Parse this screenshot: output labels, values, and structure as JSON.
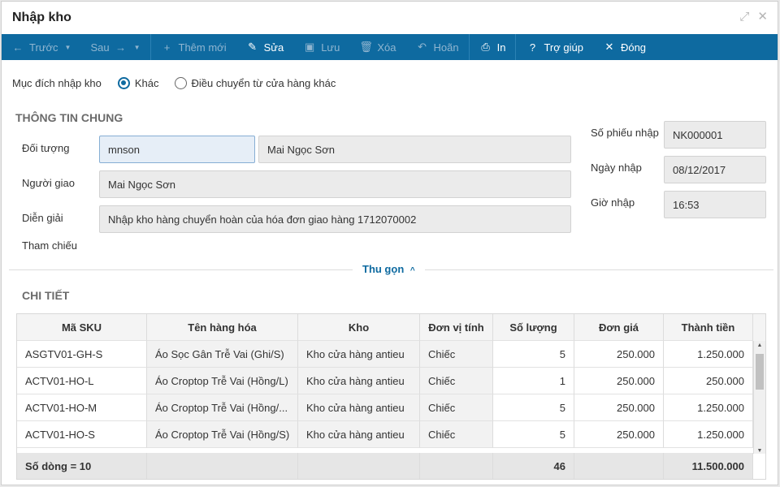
{
  "window": {
    "title": "Nhập kho"
  },
  "toolbar": [
    {
      "label": "Trước",
      "icon": "arrow-left-icon",
      "glyph": "←",
      "caret": true,
      "enabled": false
    },
    {
      "label": "Sau",
      "icon": "arrow-right-icon",
      "glyph": "→",
      "caret": true,
      "enabled": false,
      "icon_after": true
    },
    {
      "label": "Thêm mới",
      "icon": "plus-icon",
      "glyph": "+",
      "enabled": false
    },
    {
      "label": "Sửa",
      "icon": "pencil-icon",
      "glyph": "✎",
      "enabled": true
    },
    {
      "label": "Lưu",
      "icon": "save-icon",
      "glyph": "▣",
      "enabled": false
    },
    {
      "label": "Xóa",
      "icon": "trash-icon",
      "glyph": "🗑",
      "enabled": false
    },
    {
      "label": "Hoãn",
      "icon": "undo-icon",
      "glyph": "↶",
      "enabled": false
    },
    {
      "label": "In",
      "icon": "printer-icon",
      "glyph": "⎙",
      "enabled": true
    },
    {
      "label": "Trợ giúp",
      "icon": "help-icon",
      "glyph": "?",
      "enabled": true
    },
    {
      "label": "Đóng",
      "icon": "close-icon",
      "glyph": "✕",
      "enabled": true
    }
  ],
  "purpose": {
    "label": "Mục đích nhập kho",
    "options": [
      {
        "label": "Khác",
        "selected": true
      },
      {
        "label": "Điều chuyển từ cửa hàng khác",
        "selected": false
      }
    ]
  },
  "general": {
    "title": "THÔNG TIN CHUNG",
    "doi_tuong_label": "Đối tượng",
    "doi_tuong_code": "mnson",
    "doi_tuong_name": "Mai Ngọc Sơn",
    "nguoi_giao_label": "Người giao",
    "nguoi_giao": "Mai Ngọc Sơn",
    "dien_giai_label": "Diễn giải",
    "dien_giai": "Nhập kho hàng chuyển hoàn của hóa đơn giao hàng 1712070002",
    "tham_chieu_label": "Tham chiếu",
    "so_phieu_label": "Số phiếu nhập",
    "so_phieu": "NK000001",
    "ngay_nhap_label": "Ngày nhập",
    "ngay_nhap": "08/12/2017",
    "gio_nhap_label": "Giờ nhập",
    "gio_nhap": "16:53"
  },
  "collapse_label": "Thu gọn",
  "detail": {
    "title": "CHI TIẾT",
    "columns": [
      "Mã SKU",
      "Tên hàng hóa",
      "Kho",
      "Đơn vị tính",
      "Số lượng",
      "Đơn giá",
      "Thành tiền"
    ],
    "rows": [
      [
        "ASGTV01-GH-S",
        "Áo Sọc Gân Trễ Vai (Ghi/S)",
        "Kho cửa hàng antieu",
        "Chiếc",
        "5",
        "250.000",
        "1.250.000"
      ],
      [
        "ACTV01-HO-L",
        "Áo Croptop Trễ Vai (Hồng/L)",
        "Kho cửa hàng antieu",
        "Chiếc",
        "1",
        "250.000",
        "250.000"
      ],
      [
        "ACTV01-HO-M",
        "Áo Croptop Trễ Vai (Hồng/...",
        "Kho cửa hàng antieu",
        "Chiếc",
        "5",
        "250.000",
        "1.250.000"
      ],
      [
        "ACTV01-HO-S",
        "Áo Croptop Trễ Vai (Hồng/S)",
        "Kho cửa hàng antieu",
        "Chiếc",
        "5",
        "250.000",
        "1.250.000"
      ]
    ],
    "footer": {
      "row_count": "Số dòng = 10",
      "total_qty": "46",
      "total_amount": "11.500.000"
    }
  }
}
